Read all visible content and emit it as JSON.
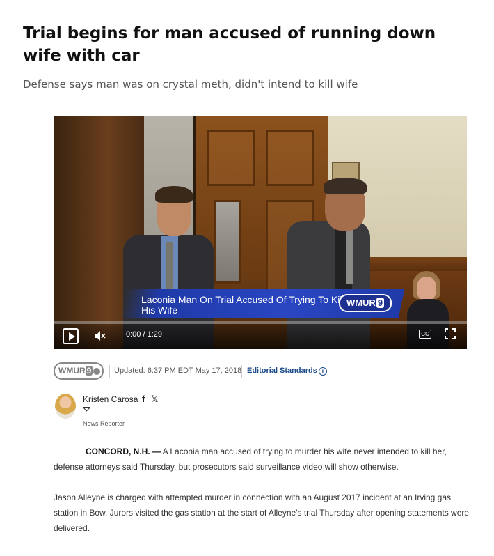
{
  "article": {
    "headline": "Trial begins for man accused of running down wife with car",
    "subhead": "Defense says man was on crystal meth, didn't intend to kill wife"
  },
  "video": {
    "lower_third": "Laconia Man On Trial Accused Of Trying To Kill His Wife",
    "station_bug": "WMUR",
    "station_bug_number": "9",
    "time_current": "0:00",
    "time_separator": "/",
    "time_total": "1:29",
    "progress": 0,
    "cc_label": "CC",
    "icons": [
      "play-icon",
      "volume-muted-icon",
      "closed-captions-icon",
      "fullscreen-icon"
    ]
  },
  "meta": {
    "station_logo": "WMUR",
    "station_logo_number": "9",
    "updated": "Updated: 6:37 PM EDT May 17, 2018",
    "editorial_standards": "Editorial Standards",
    "info_glyph": "i"
  },
  "author": {
    "name": "Kristen Carosa",
    "facebook_glyph": "f",
    "x_glyph": "𝕏",
    "role": "News Reporter"
  },
  "body": {
    "p1_dateline": "CONCORD, N.H. —",
    "p1_text": " A Laconia man accused of trying to murder his wife never intended to kill her, defense attorneys said Thursday, but prosecutors said surveillance video will show otherwise.",
    "p2_text": "Jason Alleyne is charged with attempted murder in connection with an August 2017 incident at an Irving gas station in Bow. Jurors visited the gas station at the start of Alleyne's trial Thursday after opening statements were delivered."
  },
  "colors": {
    "link": "#1a4a8a",
    "lower_third_blue": "#2a46c2"
  }
}
